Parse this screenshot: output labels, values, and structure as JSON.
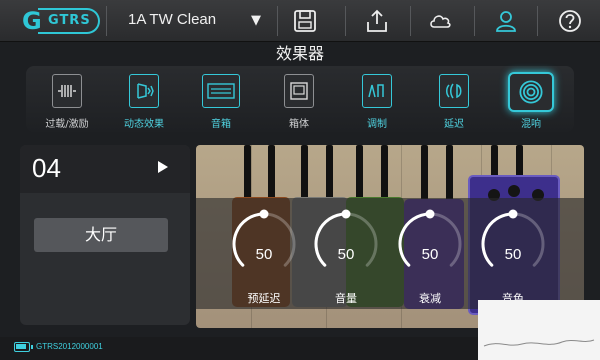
{
  "header": {
    "logo_text": "GTRS",
    "preset_name": "1A TW Clean",
    "buttons": [
      {
        "icon": "save-icon"
      },
      {
        "icon": "upload-icon"
      },
      {
        "icon": "cloud-icon"
      },
      {
        "icon": "user-icon"
      },
      {
        "icon": "help-icon"
      }
    ]
  },
  "page_title": "效果器",
  "effects": [
    {
      "label": "过载/激励",
      "icon": "overdrive-icon",
      "active": false,
      "selected": false
    },
    {
      "label": "动态效果",
      "icon": "dynamics-icon",
      "active": true,
      "selected": false
    },
    {
      "label": "音箱",
      "icon": "amp-icon",
      "active": true,
      "selected": false
    },
    {
      "label": "箱体",
      "icon": "cabinet-icon",
      "active": false,
      "selected": false
    },
    {
      "label": "调制",
      "icon": "modulation-icon",
      "active": true,
      "selected": false
    },
    {
      "label": "延迟",
      "icon": "delay-icon",
      "active": true,
      "selected": false
    },
    {
      "label": "混响",
      "icon": "reverb-icon",
      "active": true,
      "selected": true
    }
  ],
  "reverb": {
    "slot": "04",
    "type": "大厅"
  },
  "params": [
    {
      "label": "预延迟",
      "value": "50",
      "level": 0.5
    },
    {
      "label": "音量",
      "value": "50",
      "level": 0.5
    },
    {
      "label": "衰减",
      "value": "50",
      "level": 0.5
    },
    {
      "label": "音色",
      "value": "50",
      "level": 0.5
    }
  ],
  "footer": {
    "device_id": "GTRS2012000001"
  },
  "colors": {
    "accent": "#35c8d8",
    "background": "#1d1f22"
  }
}
